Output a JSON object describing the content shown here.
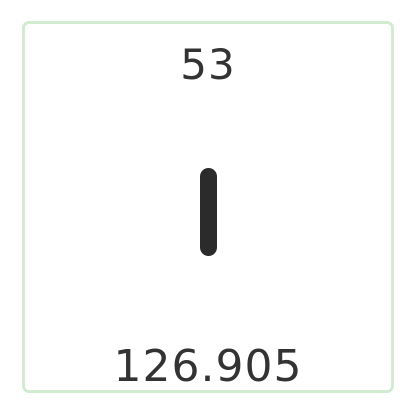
{
  "element": {
    "atomic_number": "53",
    "symbol": "I",
    "atomic_mass": "126.905"
  },
  "colors": {
    "border": "#d2ecd2",
    "text": "#333333",
    "symbol": "#2b2b2b",
    "background": "#ffffff"
  }
}
